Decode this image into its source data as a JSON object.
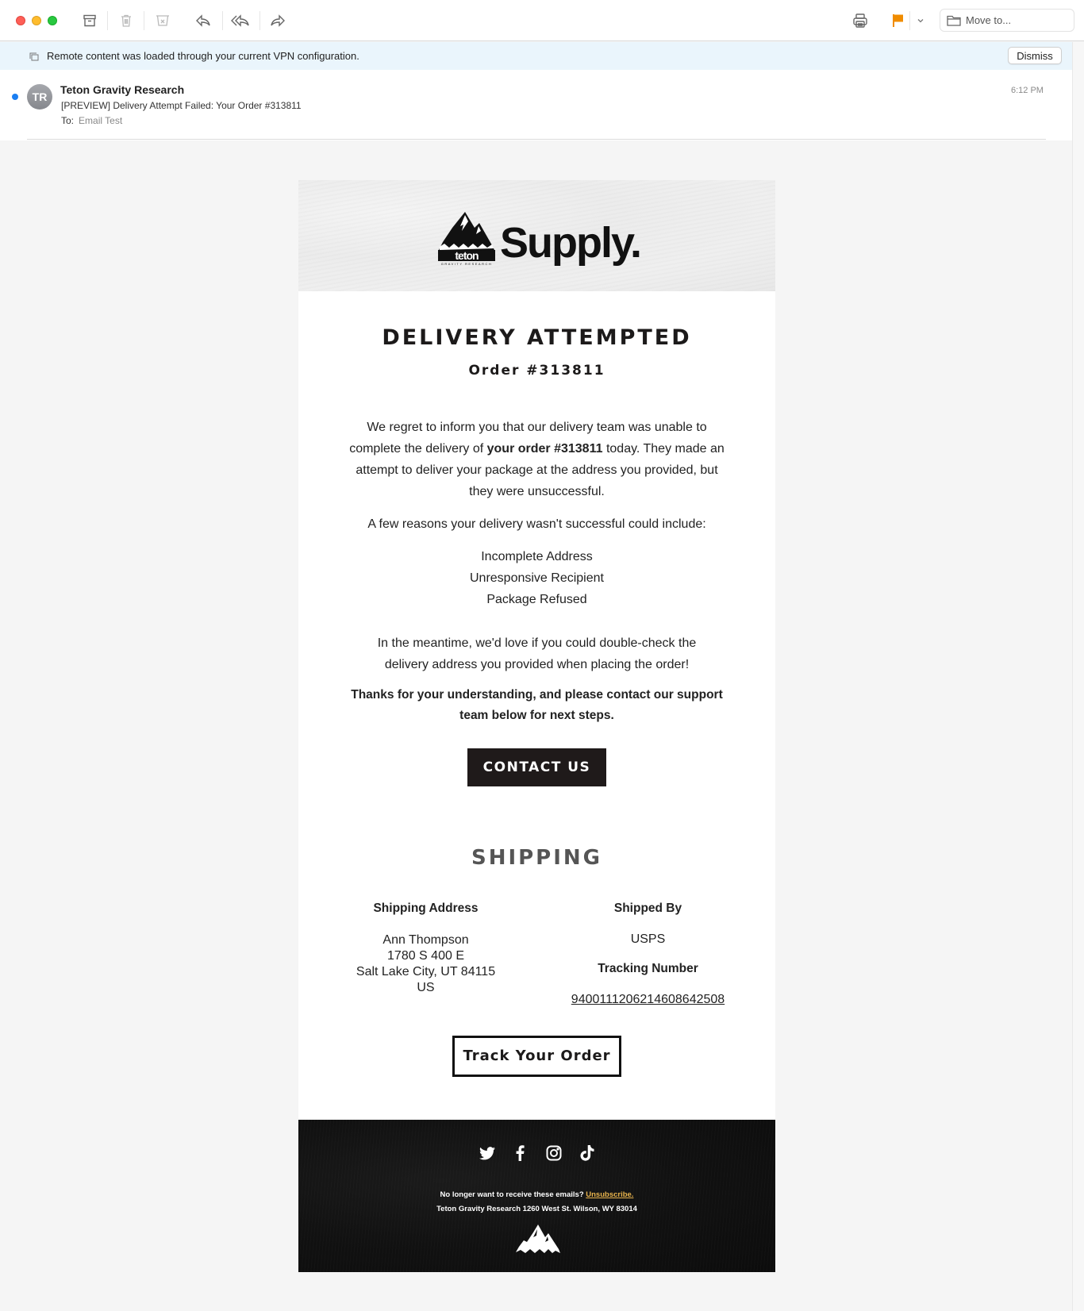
{
  "toolbar": {
    "icons": [
      "archive-icon",
      "trash-icon",
      "junk-icon",
      "reply-icon",
      "reply-all-icon",
      "forward-icon",
      "print-icon",
      "flag-icon",
      "chevron-down-icon",
      "folder-icon"
    ],
    "move_to_label": "Move to...",
    "flag_color": "#f08c00"
  },
  "banner": {
    "text": "Remote content was loaded through your current VPN configuration.",
    "dismiss_label": "Dismiss"
  },
  "message": {
    "avatar_initials": "TR",
    "sender": "Teton Gravity Research",
    "subject": "[PREVIEW] Delivery Attempt Failed: Your Order #313811",
    "to_label": "To:",
    "to_value": "Email Test",
    "time": "6:12 PM"
  },
  "email": {
    "logo_word": "Supply.",
    "logo_alt": "Teton Gravity Research",
    "title": "DELIVERY ATTEMPTED",
    "order_label": "Order #313811",
    "paragraph1_pre": "We regret to inform you that our delivery team was unable to complete the delivery of ",
    "paragraph1_bold": "your order #313811",
    "paragraph1_post": " today. They made an attempt to deliver your package at the address you provided, but they were unsuccessful.",
    "paragraph2": "A few reasons your delivery wasn't successful could include:",
    "reasons": [
      "Incomplete Address",
      "Unresponsive Recipient",
      "Package Refused"
    ],
    "paragraph3": "In the meantime, we'd love if you could double-check the delivery address you provided when placing the order!",
    "paragraph4": "Thanks for your understanding, and please contact our support team below for next steps.",
    "contact_button": "CONTACT US",
    "shipping_title": "SHIPPING",
    "shipping_address_label": "Shipping Address",
    "address_lines": [
      "Ann Thompson",
      "1780 S 400 E",
      "Salt Lake City, UT 84115",
      "US"
    ],
    "shipped_by_label": "Shipped By",
    "carrier": "USPS",
    "tracking_label": "Tracking Number",
    "tracking_number": "9400111206214608642508",
    "track_button": "Track Your Order",
    "footer": {
      "social": [
        "twitter-icon",
        "facebook-icon",
        "instagram-icon",
        "tiktok-icon"
      ],
      "unsubscribe_prefix": "No longer want to receive these emails? ",
      "unsubscribe_link": "Unsubscribe.",
      "address": "Teton Gravity Research 1260 West St. Wilson, WY 83014",
      "link_color": "#e8b34c"
    }
  }
}
